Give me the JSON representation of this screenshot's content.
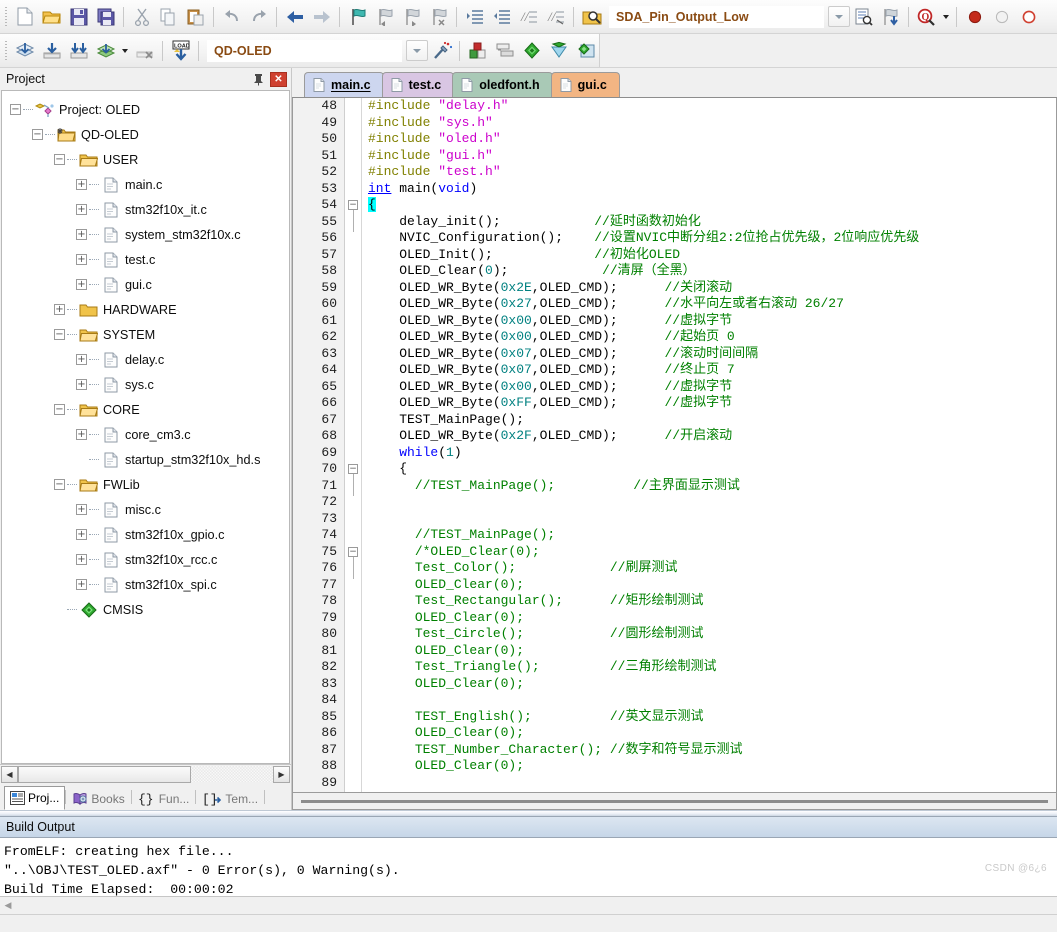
{
  "toolbars": {
    "row1": {
      "buttons": [
        {
          "name": "new-file-icon",
          "glyph": "new"
        },
        {
          "name": "open-file-icon",
          "glyph": "open"
        },
        {
          "name": "save-icon",
          "glyph": "save"
        },
        {
          "name": "save-all-icon",
          "glyph": "saveall"
        },
        {
          "name": "cut-icon",
          "glyph": "cut"
        },
        {
          "name": "copy-icon",
          "glyph": "copy"
        },
        {
          "name": "paste-icon",
          "glyph": "paste"
        },
        {
          "name": "undo-icon",
          "glyph": "undo"
        },
        {
          "name": "redo-icon",
          "glyph": "redo"
        },
        {
          "name": "navigate-backward-icon",
          "glyph": "back"
        },
        {
          "name": "navigate-forward-icon",
          "glyph": "forward"
        },
        {
          "name": "insert-bookmark-icon",
          "glyph": "bm1"
        },
        {
          "name": "previous-bookmark-icon",
          "glyph": "bm2"
        },
        {
          "name": "next-bookmark-icon",
          "glyph": "bm3"
        },
        {
          "name": "clear-bookmarks-icon",
          "glyph": "bm4"
        },
        {
          "name": "indent-icon",
          "glyph": "indent"
        },
        {
          "name": "outdent-icon",
          "glyph": "outdent"
        },
        {
          "name": "comment-icon",
          "glyph": "comment"
        },
        {
          "name": "uncomment-icon",
          "glyph": "uncomment"
        },
        {
          "name": "find-in-files-icon",
          "glyph": "findfiles"
        }
      ],
      "search_value": "SDA_Pin_Output_Low",
      "search_placeholder": "",
      "after_buttons": [
        {
          "name": "find-in-files-button-icon",
          "glyph": "findinfiles2"
        },
        {
          "name": "bookmark-jump-icon",
          "glyph": "jump"
        },
        {
          "name": "configuration-wizard-icon",
          "glyph": "magnify"
        }
      ],
      "debug_icons": [
        {
          "name": "insert-breakpoint-icon",
          "glyph": "bp-red"
        },
        {
          "name": "disable-breakpoint-icon",
          "glyph": "bp-gray"
        },
        {
          "name": "kill-all-breakpoints-icon",
          "glyph": "bp-red-outline"
        }
      ]
    },
    "row2": {
      "buttons": [
        {
          "name": "translate-icon",
          "glyph": "translate"
        },
        {
          "name": "build-icon",
          "glyph": "build"
        },
        {
          "name": "rebuild-icon",
          "glyph": "rebuild"
        },
        {
          "name": "batch-build-icon",
          "glyph": "batchbuild"
        },
        {
          "name": "stop-build-icon",
          "glyph": "stopbuild"
        },
        {
          "name": "download-icon",
          "glyph": "load"
        }
      ],
      "target_value": "QD-OLED",
      "after_buttons": [
        {
          "name": "target-options-icon",
          "glyph": "wand"
        },
        {
          "name": "manage-project-items-icon",
          "glyph": "manage"
        },
        {
          "name": "manage-multi-project-icon",
          "glyph": "multiproject"
        },
        {
          "name": "pack-installer-icon",
          "glyph": "green-diamond"
        },
        {
          "name": "manage-run-time-env-icon",
          "glyph": "green-cone"
        },
        {
          "name": "select-software-packs-icon",
          "glyph": "packs"
        }
      ]
    }
  },
  "project_panel": {
    "title": "Project",
    "pin_label": "·",
    "close_label": "✕",
    "tree": [
      {
        "depth": 0,
        "toggle": "minus",
        "icon": "project-icon",
        "label": "Project: OLED"
      },
      {
        "depth": 1,
        "toggle": "minus",
        "icon": "target-icon",
        "label": "QD-OLED"
      },
      {
        "depth": 2,
        "toggle": "minus",
        "icon": "folder-open",
        "label": "USER"
      },
      {
        "depth": 3,
        "toggle": "plus",
        "icon": "c-file",
        "label": "main.c"
      },
      {
        "depth": 3,
        "toggle": "plus",
        "icon": "c-file",
        "label": "stm32f10x_it.c"
      },
      {
        "depth": 3,
        "toggle": "plus",
        "icon": "c-file",
        "label": "system_stm32f10x.c"
      },
      {
        "depth": 3,
        "toggle": "plus",
        "icon": "c-file",
        "label": "test.c"
      },
      {
        "depth": 3,
        "toggle": "plus",
        "icon": "c-file",
        "label": "gui.c"
      },
      {
        "depth": 2,
        "toggle": "plus",
        "icon": "folder-closed",
        "label": "HARDWARE"
      },
      {
        "depth": 2,
        "toggle": "minus",
        "icon": "folder-open",
        "label": "SYSTEM"
      },
      {
        "depth": 3,
        "toggle": "plus",
        "icon": "c-file",
        "label": "delay.c"
      },
      {
        "depth": 3,
        "toggle": "plus",
        "icon": "c-file",
        "label": "sys.c"
      },
      {
        "depth": 2,
        "toggle": "minus",
        "icon": "folder-open",
        "label": "CORE"
      },
      {
        "depth": 3,
        "toggle": "plus",
        "icon": "c-file",
        "label": "core_cm3.c"
      },
      {
        "depth": 3,
        "toggle": "none",
        "icon": "c-file",
        "label": "startup_stm32f10x_hd.s"
      },
      {
        "depth": 2,
        "toggle": "minus",
        "icon": "folder-open",
        "label": "FWLib"
      },
      {
        "depth": 3,
        "toggle": "plus",
        "icon": "c-file",
        "label": "misc.c"
      },
      {
        "depth": 3,
        "toggle": "plus",
        "icon": "c-file",
        "label": "stm32f10x_gpio.c"
      },
      {
        "depth": 3,
        "toggle": "plus",
        "icon": "c-file",
        "label": "stm32f10x_rcc.c"
      },
      {
        "depth": 3,
        "toggle": "plus",
        "icon": "c-file",
        "label": "stm32f10x_spi.c"
      },
      {
        "depth": 2,
        "toggle": "none",
        "icon": "cmsis-icon",
        "label": "CMSIS"
      }
    ],
    "bottom_tabs": [
      {
        "name": "tab-project",
        "label": "Proj...",
        "icon": "project-tab-icon",
        "active": true
      },
      {
        "name": "tab-books",
        "label": "Books",
        "icon": "books-icon",
        "active": false
      },
      {
        "name": "tab-functions",
        "label": "Fun...",
        "icon": "functions-icon",
        "active": false
      },
      {
        "name": "tab-templates",
        "label": "Tem...",
        "icon": "templates-icon",
        "active": false
      }
    ]
  },
  "editor": {
    "tabs": [
      {
        "label": "main.c",
        "color": "#cdd6ef",
        "selected": true
      },
      {
        "label": "test.c",
        "color": "#d9c6e3",
        "selected": false
      },
      {
        "label": "oledfont.h",
        "color": "#a9c9b6",
        "selected": false
      },
      {
        "label": "gui.c",
        "color": "#f2b583",
        "selected": false
      }
    ],
    "first_line": 48,
    "lines": [
      {
        "n": 48,
        "fold": "",
        "tokens": [
          {
            "t": "#include ",
            "c": "pre"
          },
          {
            "t": "\"delay.h\"",
            "c": "str"
          }
        ]
      },
      {
        "n": 49,
        "fold": "",
        "tokens": [
          {
            "t": "#include ",
            "c": "pre"
          },
          {
            "t": "\"sys.h\"",
            "c": "str"
          }
        ]
      },
      {
        "n": 50,
        "fold": "",
        "tokens": [
          {
            "t": "#include ",
            "c": "pre"
          },
          {
            "t": "\"oled.h\"",
            "c": "str"
          }
        ]
      },
      {
        "n": 51,
        "fold": "",
        "tokens": [
          {
            "t": "#include ",
            "c": "pre"
          },
          {
            "t": "\"gui.h\"",
            "c": "str"
          }
        ]
      },
      {
        "n": 52,
        "fold": "",
        "tokens": [
          {
            "t": "#include ",
            "c": "pre"
          },
          {
            "t": "\"test.h\"",
            "c": "str"
          }
        ]
      },
      {
        "n": 53,
        "fold": "",
        "tokens": [
          {
            "t": "int",
            "c": "kw-u"
          },
          {
            "t": " main(",
            "c": ""
          },
          {
            "t": "void",
            "c": "kw"
          },
          {
            "t": ")",
            "c": ""
          }
        ]
      },
      {
        "n": 54,
        "fold": "minus",
        "tokens": [
          {
            "t": "{",
            "c": "brace-hl"
          }
        ]
      },
      {
        "n": 55,
        "fold": "",
        "tokens": [
          {
            "t": "    delay_init();            ",
            "c": ""
          },
          {
            "t": "//延时函数初始化",
            "c": "cmt"
          }
        ]
      },
      {
        "n": 56,
        "fold": "",
        "tokens": [
          {
            "t": "    NVIC_Configuration();    ",
            "c": ""
          },
          {
            "t": "//设置NVIC中断分组2:2位抢占优先级，2位响应优先级",
            "c": "cmt"
          }
        ]
      },
      {
        "n": 57,
        "fold": "",
        "tokens": [
          {
            "t": "    OLED_Init();             ",
            "c": ""
          },
          {
            "t": "//初始化OLED",
            "c": "cmt"
          }
        ]
      },
      {
        "n": 58,
        "fold": "",
        "tokens": [
          {
            "t": "    OLED_Clear(",
            "c": ""
          },
          {
            "t": "0",
            "c": "num"
          },
          {
            "t": ");            ",
            "c": ""
          },
          {
            "t": "//清屏（全黑）",
            "c": "cmt"
          }
        ]
      },
      {
        "n": 59,
        "fold": "",
        "tokens": [
          {
            "t": "    OLED_WR_Byte(",
            "c": ""
          },
          {
            "t": "0x2E",
            "c": "num"
          },
          {
            "t": ",OLED_CMD);      ",
            "c": ""
          },
          {
            "t": "//关闭滚动",
            "c": "cmt"
          }
        ]
      },
      {
        "n": 60,
        "fold": "",
        "tokens": [
          {
            "t": "    OLED_WR_Byte(",
            "c": ""
          },
          {
            "t": "0x27",
            "c": "num"
          },
          {
            "t": ",OLED_CMD);      ",
            "c": ""
          },
          {
            "t": "//水平向左或者右滚动 26/27",
            "c": "cmt"
          }
        ]
      },
      {
        "n": 61,
        "fold": "",
        "tokens": [
          {
            "t": "    OLED_WR_Byte(",
            "c": ""
          },
          {
            "t": "0x00",
            "c": "num"
          },
          {
            "t": ",OLED_CMD);      ",
            "c": ""
          },
          {
            "t": "//虚拟字节",
            "c": "cmt"
          }
        ]
      },
      {
        "n": 62,
        "fold": "",
        "tokens": [
          {
            "t": "    OLED_WR_Byte(",
            "c": ""
          },
          {
            "t": "0x00",
            "c": "num"
          },
          {
            "t": ",OLED_CMD);      ",
            "c": ""
          },
          {
            "t": "//起始页 0",
            "c": "cmt"
          }
        ]
      },
      {
        "n": 63,
        "fold": "",
        "tokens": [
          {
            "t": "    OLED_WR_Byte(",
            "c": ""
          },
          {
            "t": "0x07",
            "c": "num"
          },
          {
            "t": ",OLED_CMD);      ",
            "c": ""
          },
          {
            "t": "//滚动时间间隔",
            "c": "cmt"
          }
        ]
      },
      {
        "n": 64,
        "fold": "",
        "tokens": [
          {
            "t": "    OLED_WR_Byte(",
            "c": ""
          },
          {
            "t": "0x07",
            "c": "num"
          },
          {
            "t": ",OLED_CMD);      ",
            "c": ""
          },
          {
            "t": "//终止页 7",
            "c": "cmt"
          }
        ]
      },
      {
        "n": 65,
        "fold": "",
        "tokens": [
          {
            "t": "    OLED_WR_Byte(",
            "c": ""
          },
          {
            "t": "0x00",
            "c": "num"
          },
          {
            "t": ",OLED_CMD);      ",
            "c": ""
          },
          {
            "t": "//虚拟字节",
            "c": "cmt"
          }
        ]
      },
      {
        "n": 66,
        "fold": "",
        "tokens": [
          {
            "t": "    OLED_WR_Byte(",
            "c": ""
          },
          {
            "t": "0xFF",
            "c": "num"
          },
          {
            "t": ",OLED_CMD);      ",
            "c": ""
          },
          {
            "t": "//虚拟字节",
            "c": "cmt"
          }
        ]
      },
      {
        "n": 67,
        "fold": "",
        "tokens": [
          {
            "t": "    TEST_MainPage();",
            "c": ""
          }
        ]
      },
      {
        "n": 68,
        "fold": "",
        "tokens": [
          {
            "t": "    OLED_WR_Byte(",
            "c": ""
          },
          {
            "t": "0x2F",
            "c": "num"
          },
          {
            "t": ",OLED_CMD);      ",
            "c": ""
          },
          {
            "t": "//开启滚动",
            "c": "cmt"
          }
        ]
      },
      {
        "n": 69,
        "fold": "",
        "tokens": [
          {
            "t": "    while",
            "c": "kw"
          },
          {
            "t": "(",
            "c": ""
          },
          {
            "t": "1",
            "c": "num"
          },
          {
            "t": ")",
            "c": ""
          }
        ]
      },
      {
        "n": 70,
        "fold": "minus",
        "tokens": [
          {
            "t": "    {",
            "c": ""
          }
        ]
      },
      {
        "n": 71,
        "fold": "",
        "tokens": [
          {
            "t": "      ",
            "c": ""
          },
          {
            "t": "//TEST_MainPage();          //主界面显示测试",
            "c": "cmt"
          }
        ]
      },
      {
        "n": 72,
        "fold": "",
        "tokens": [
          {
            "t": "",
            "c": ""
          }
        ]
      },
      {
        "n": 73,
        "fold": "",
        "tokens": [
          {
            "t": "",
            "c": ""
          }
        ]
      },
      {
        "n": 74,
        "fold": "",
        "tokens": [
          {
            "t": "      ",
            "c": ""
          },
          {
            "t": "//TEST_MainPage();",
            "c": "cmt"
          }
        ]
      },
      {
        "n": 75,
        "fold": "minus",
        "tokens": [
          {
            "t": "      ",
            "c": ""
          },
          {
            "t": "/*OLED_Clear(0);",
            "c": "cmt"
          }
        ]
      },
      {
        "n": 76,
        "fold": "",
        "tokens": [
          {
            "t": "      ",
            "c": ""
          },
          {
            "t": "Test_Color();            //刷屏测试",
            "c": "cmt"
          }
        ]
      },
      {
        "n": 77,
        "fold": "",
        "tokens": [
          {
            "t": "      ",
            "c": ""
          },
          {
            "t": "OLED_Clear(0);",
            "c": "cmt"
          }
        ]
      },
      {
        "n": 78,
        "fold": "",
        "tokens": [
          {
            "t": "      ",
            "c": ""
          },
          {
            "t": "Test_Rectangular();      //矩形绘制测试",
            "c": "cmt"
          }
        ]
      },
      {
        "n": 79,
        "fold": "",
        "tokens": [
          {
            "t": "      ",
            "c": ""
          },
          {
            "t": "OLED_Clear(0);",
            "c": "cmt"
          }
        ]
      },
      {
        "n": 80,
        "fold": "",
        "tokens": [
          {
            "t": "      ",
            "c": ""
          },
          {
            "t": "Test_Circle();           //圆形绘制测试",
            "c": "cmt"
          }
        ]
      },
      {
        "n": 81,
        "fold": "",
        "tokens": [
          {
            "t": "      ",
            "c": ""
          },
          {
            "t": "OLED_Clear(0);",
            "c": "cmt"
          }
        ]
      },
      {
        "n": 82,
        "fold": "",
        "tokens": [
          {
            "t": "      ",
            "c": ""
          },
          {
            "t": "Test_Triangle();         //三角形绘制测试",
            "c": "cmt"
          }
        ]
      },
      {
        "n": 83,
        "fold": "",
        "tokens": [
          {
            "t": "      ",
            "c": ""
          },
          {
            "t": "OLED_Clear(0);",
            "c": "cmt"
          }
        ]
      },
      {
        "n": 84,
        "fold": "",
        "tokens": [
          {
            "t": "",
            "c": ""
          }
        ]
      },
      {
        "n": 85,
        "fold": "",
        "tokens": [
          {
            "t": "      ",
            "c": ""
          },
          {
            "t": "TEST_English();          //英文显示测试",
            "c": "cmt"
          }
        ]
      },
      {
        "n": 86,
        "fold": "",
        "tokens": [
          {
            "t": "      ",
            "c": ""
          },
          {
            "t": "OLED_Clear(0);",
            "c": "cmt"
          }
        ]
      },
      {
        "n": 87,
        "fold": "",
        "tokens": [
          {
            "t": "      ",
            "c": ""
          },
          {
            "t": "TEST_Number_Character(); //数字和符号显示测试",
            "c": "cmt"
          }
        ]
      },
      {
        "n": 88,
        "fold": "",
        "tokens": [
          {
            "t": "      ",
            "c": ""
          },
          {
            "t": "OLED_Clear(0);",
            "c": "cmt"
          }
        ]
      },
      {
        "n": 89,
        "fold": "",
        "tokens": [
          {
            "t": "",
            "c": ""
          }
        ]
      }
    ]
  },
  "build_output": {
    "title": "Build Output",
    "lines": [
      "FromELF: creating hex file...",
      "\"..\\OBJ\\TEST_OLED.axf\" - 0 Error(s), 0 Warning(s).",
      "Build Time Elapsed:  00:00:02"
    ]
  },
  "watermark": "CSDN @6¿6",
  "colors": {
    "keyword": "#0000ff",
    "string": "#cc00cc",
    "preprocessor": "#808000",
    "number": "#008080",
    "comment": "#008000",
    "brand_orange": "#8a4b13"
  }
}
